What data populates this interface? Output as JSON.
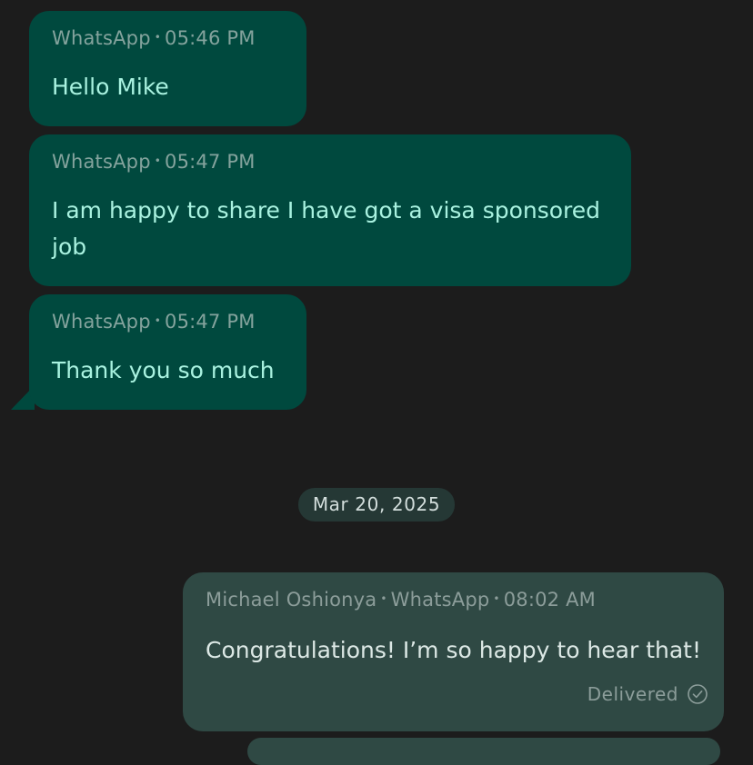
{
  "messages": [
    {
      "source": "WhatsApp",
      "time": "05:46 PM",
      "text": "Hello Mike"
    },
    {
      "source": "WhatsApp",
      "time": "05:47 PM",
      "text": "I am happy to share I have got a visa sponsored job"
    },
    {
      "source": "WhatsApp",
      "time": "05:47 PM",
      "text": "Thank you so much"
    }
  ],
  "date_separator": "Mar 20, 2025",
  "outgoing": {
    "sender": "Michael Oshionya",
    "source": "WhatsApp",
    "time": "08:02 AM",
    "text": "Congratulations! I’m so happy to hear that!",
    "status": "Delivered"
  },
  "separator_dot": "•",
  "colors": {
    "background": "#1c1c1c",
    "incoming_bubble": "#00493e",
    "incoming_text": "#a9f2e0",
    "outgoing_bubble": "#2f4944",
    "outgoing_text": "#dce8e5"
  },
  "icons": {
    "delivered": "check-circle-icon"
  }
}
